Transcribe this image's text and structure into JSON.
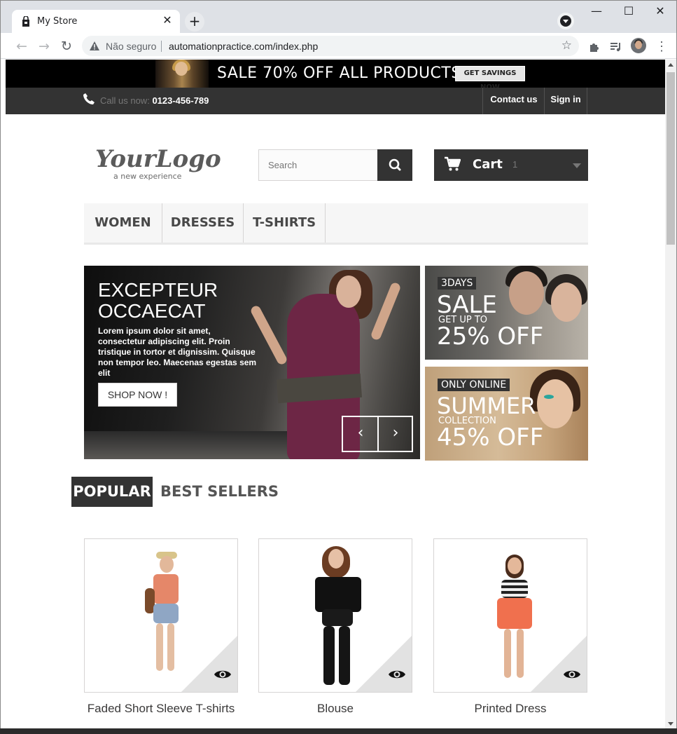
{
  "browser": {
    "tab_title": "My Store",
    "tab_close": "✕",
    "new_tab": "+",
    "window_buttons": {
      "minimize": "—",
      "maximize": "☐",
      "close": "✕"
    },
    "security_label": "Não seguro",
    "url": "automationpractice.com/index.php",
    "icons": [
      "back-arrow-icon",
      "forward-arrow-icon",
      "reload-icon",
      "warning-icon",
      "star-icon",
      "extensions-icon",
      "media-icon",
      "profile-avatar",
      "menu-dots-icon"
    ]
  },
  "promo": {
    "text": "SALE 70% OFF ALL PRODUCTS",
    "button": "GET SAVINGS NOW"
  },
  "header": {
    "call_prefix": "Call us now:",
    "phone": "0123-456-789",
    "contact": "Contact us",
    "signin": "Sign in"
  },
  "logo": {
    "main": "YourLogo",
    "tagline": "a new experience"
  },
  "search": {
    "placeholder": "Search"
  },
  "cart": {
    "label": "Cart",
    "qty": "1"
  },
  "menu": [
    "WOMEN",
    "DRESSES",
    "T-SHIRTS"
  ],
  "slider": {
    "title_line1": "EXCEPTEUR",
    "title_line2": "OCCAECAT",
    "text": "Lorem ipsum dolor sit amet, consectetur adipiscing elit. Proin tristique in tortor et dignissim. Quisque non tempor leo. Maecenas egestas sem elit",
    "button": "SHOP NOW !",
    "prev": "‹",
    "next": "›"
  },
  "banners": [
    {
      "tag": "3DAYS",
      "big": "SALE",
      "small": "GET UP TO",
      "big2": "25% OFF"
    },
    {
      "tag": "ONLY ONLINE",
      "big": "SUMMER",
      "small": "COLLECTION",
      "big2": "45% OFF"
    }
  ],
  "tabs": {
    "popular": "POPULAR",
    "best_sellers": "BEST SELLERS"
  },
  "products": [
    {
      "name": "Faded Short Sleeve T-shirts"
    },
    {
      "name": "Blouse"
    },
    {
      "name": "Printed Dress"
    }
  ],
  "colors": {
    "dark": "#333333",
    "promo_bg": "#000000",
    "menu_bg": "#f6f6f6",
    "text": "#3a3939"
  }
}
